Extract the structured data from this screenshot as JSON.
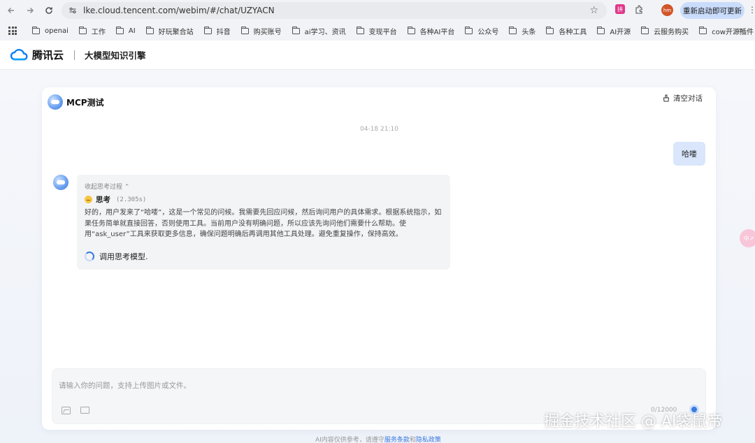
{
  "browser": {
    "url": "lke.cloud.tencent.com/webim/#/chat/UZYACN",
    "ext_label": "拼",
    "avatar_initials": "hm",
    "update_label": "重新启动即可更新",
    "more_label": "»"
  },
  "bookmarks": [
    {
      "label": "openai"
    },
    {
      "label": "工作"
    },
    {
      "label": "AI"
    },
    {
      "label": "好玩聚合站"
    },
    {
      "label": "抖音"
    },
    {
      "label": "购买账号"
    },
    {
      "label": "ai学习、资讯"
    },
    {
      "label": "变现平台"
    },
    {
      "label": "各种AI平台"
    },
    {
      "label": "公众号"
    },
    {
      "label": "头条"
    },
    {
      "label": "各种工具"
    },
    {
      "label": "AI开源"
    },
    {
      "label": "云服务购买"
    },
    {
      "label": "cow开源插件"
    }
  ],
  "app": {
    "logo_text": "腾讯云",
    "product_name": "大模型知识引擎"
  },
  "chat": {
    "title": "MCP测试",
    "clear_label": "清空对话",
    "timestamp": "04-18 21:10",
    "user_message": "哈喽",
    "collapse_label": "收起思考过程 ⌃",
    "think_label": "思考",
    "think_time": "(2.305s)",
    "think_text": "好的，用户发来了“哈喽”，这是一个常见的问候。我需要先回应问候，然后询问用户的具体需求。根据系统指示，如果任务简单就直接回答，否则使用工具。当前用户没有明确问题，所以应该先询问他们需要什么帮助。使用“ask_user”工具来获取更多信息，确保问题明确后再调用其他工具处理。避免重复操作，保持高效。",
    "loading_text": "调用思考模型."
  },
  "input": {
    "placeholder": "请输入你的问题，支持上传图片或文件。",
    "char_count": "0/12000"
  },
  "footer": {
    "disclaimer_prefix": "AI内容仅供参考，请遵守",
    "terms_link": "服务条款",
    "and": "和",
    "privacy_link": "隐私政策"
  },
  "side_widget_label": "中↗",
  "watermark": "掘金技术社区 @ AI袋鼠帝"
}
